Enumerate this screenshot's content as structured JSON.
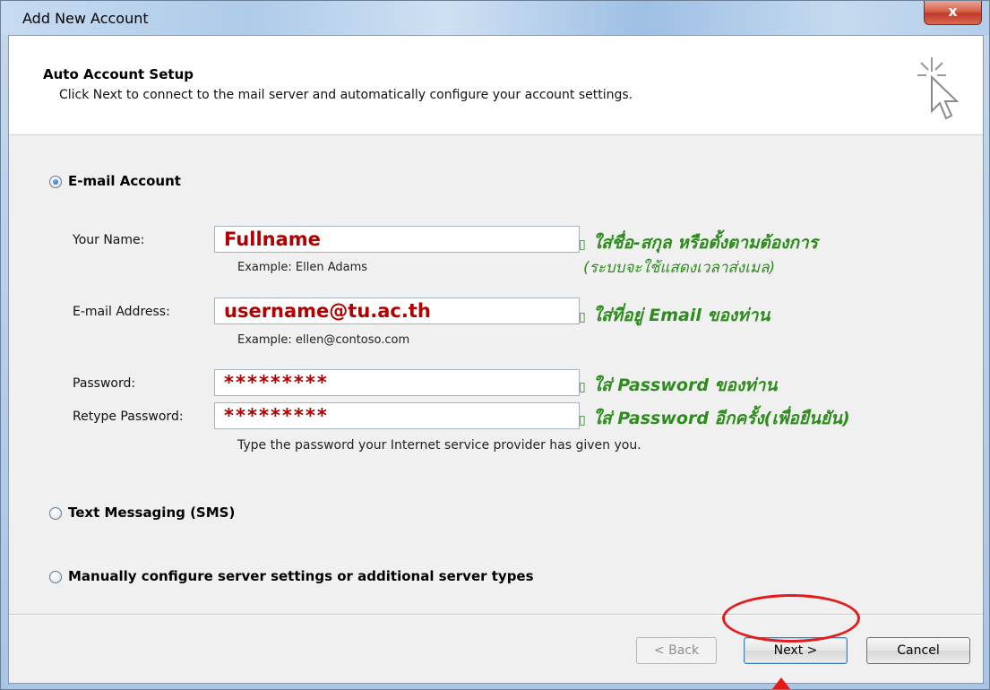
{
  "window": {
    "title": "Add New Account",
    "close_label": "x"
  },
  "header": {
    "title": "Auto Account Setup",
    "subtitle": "Click Next to connect to the mail server and automatically configure your account settings."
  },
  "options": {
    "email": {
      "label": "E-mail Account",
      "selected": true
    },
    "sms": {
      "label": "Text Messaging (SMS)",
      "selected": false
    },
    "manual": {
      "label": "Manually configure server settings or additional server types",
      "selected": false
    }
  },
  "form": {
    "name": {
      "label": "Your Name:",
      "value": "Fullname",
      "example": "Example: Ellen Adams"
    },
    "email": {
      "label": "E-mail Address:",
      "value": "username@tu.ac.th",
      "example": "Example: ellen@contoso.com"
    },
    "password": {
      "label": "Password:",
      "value": "*********"
    },
    "retype": {
      "label": "Retype Password:",
      "value": "*********"
    },
    "password_hint": "Type the password your Internet service provider has given you."
  },
  "annotations": {
    "bullet": "▯",
    "name": "ใส่ชื่อ-สกุล หรือตั้งตามต้องการ",
    "name_sub": "(ระบบจะใช้แสดงเวลาส่งเมล)",
    "email": "ใส่ที่อยู่ Email ของท่าน",
    "password": "ใส่ Password ของท่าน",
    "retype": "ใส่ Password อีกครั้ง(เพื่อยืนยัน)",
    "highlight_color": "#e31b1b",
    "text_color": "#2e8b1e"
  },
  "buttons": {
    "back": "< Back",
    "next": "Next >",
    "cancel": "Cancel"
  }
}
